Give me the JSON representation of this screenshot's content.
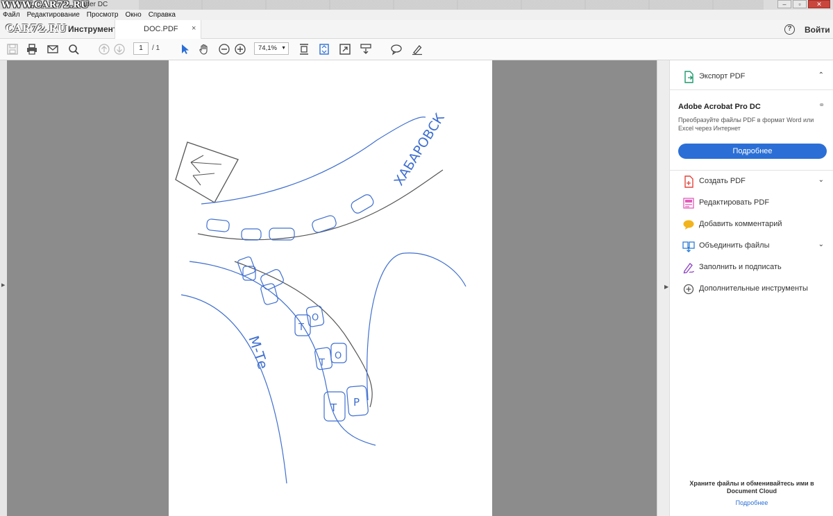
{
  "watermark": {
    "top": "WWW.CAR72.RU",
    "mid": "CAR72.RU"
  },
  "window": {
    "title": "ader DC"
  },
  "menu": [
    "Файл",
    "Редактирование",
    "Просмотр",
    "Окно",
    "Справка"
  ],
  "tabs": {
    "tools": "Инструменты",
    "doc": "DOC.PDF",
    "doc_close": "×"
  },
  "header": {
    "help": "?",
    "signin": "Войти"
  },
  "toolbar": {
    "page_current": "1",
    "page_total": "/ 1",
    "zoom": "74,1%"
  },
  "document": {
    "label_top": "ХАБАРОВСК",
    "label_bottom": "М-Те",
    "car_marks": [
      "Т",
      "О",
      "Т",
      "О",
      "Т",
      "Р"
    ]
  },
  "right_panel": {
    "export": "Экспорт PDF",
    "promo_title": "Adobe Acrobat Pro DC",
    "promo_text": "Преобразуйте файлы PDF в формат Word или Excel через Интернет",
    "promo_button": "Подробнее",
    "tools": [
      {
        "label": "Создать PDF",
        "icon": "create-pdf-icon",
        "color": "#e0443b",
        "chevron": true
      },
      {
        "label": "Редактировать PDF",
        "icon": "edit-pdf-icon",
        "color": "#e25ab8",
        "chevron": false
      },
      {
        "label": "Добавить комментарий",
        "icon": "comment-icon",
        "color": "#f2b41c",
        "chevron": false
      },
      {
        "label": "Объединить файлы",
        "icon": "combine-files-icon",
        "color": "#2b7dd6",
        "chevron": true
      },
      {
        "label": "Заполнить и подписать",
        "icon": "fill-sign-icon",
        "color": "#8a3fc2",
        "chevron": false
      },
      {
        "label": "Дополнительные инструменты",
        "icon": "more-tools-icon",
        "color": "#555555",
        "chevron": false
      }
    ],
    "cloud_text": "Храните файлы и обменивайтесь ими в Document Cloud",
    "cloud_link": "Подробнее"
  }
}
